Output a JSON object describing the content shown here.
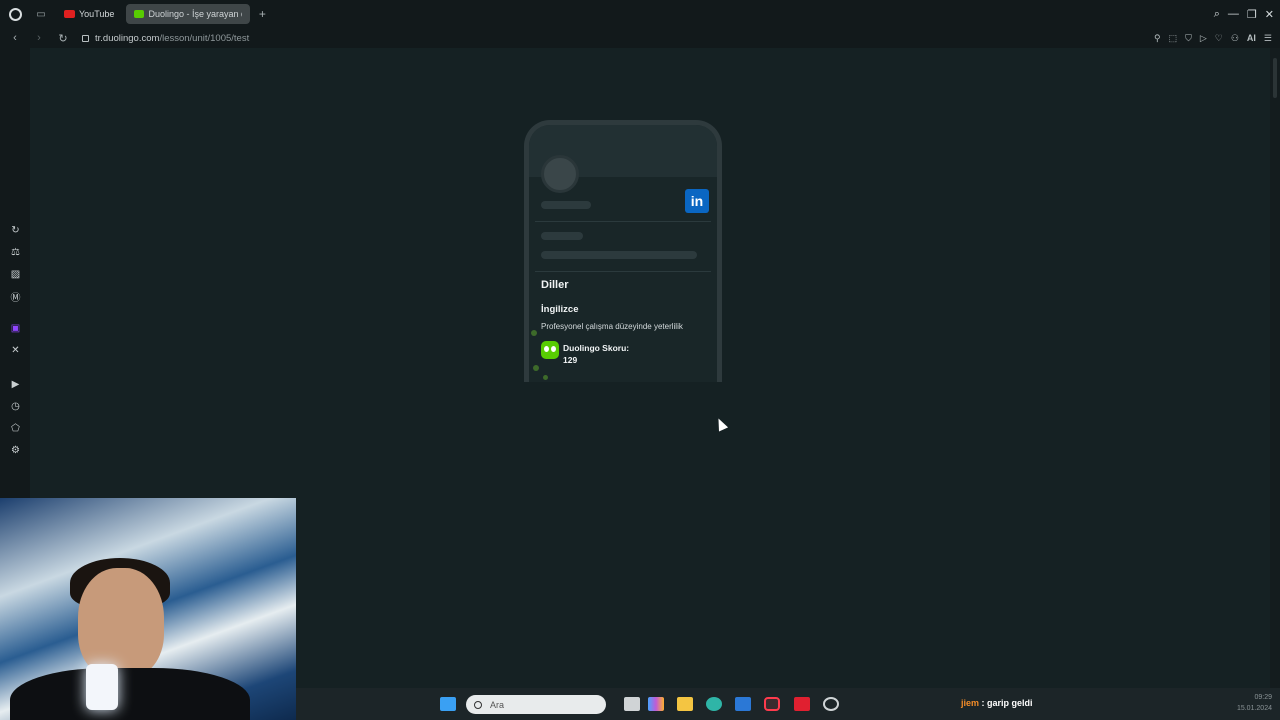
{
  "tabs": [
    {
      "label": "YouTube"
    },
    {
      "label": "Duolingo - İşe yarayan de"
    }
  ],
  "address": {
    "host": "tr.duolingo.com",
    "path": "/lesson/unit/1005/test"
  },
  "addr_right": {
    "ai_label": "AI"
  },
  "card": {
    "section_title": "Diller",
    "language": "İngilizce",
    "level": "Profesyonel çalışma düzeyinde yeterlilik",
    "score_label": "Duolingo Skoru:",
    "score_value": "129",
    "linkedin_label": "in"
  },
  "taskbar": {
    "search_placeholder": "Ara",
    "chat_user": "jiem",
    "chat_message": " : garip geldi",
    "time": "09:29",
    "date": "15.01.2024"
  },
  "colors": {
    "content_bg": "#152123",
    "duolingo_green": "#58cc02",
    "linkedin_blue": "#0a66c2"
  }
}
